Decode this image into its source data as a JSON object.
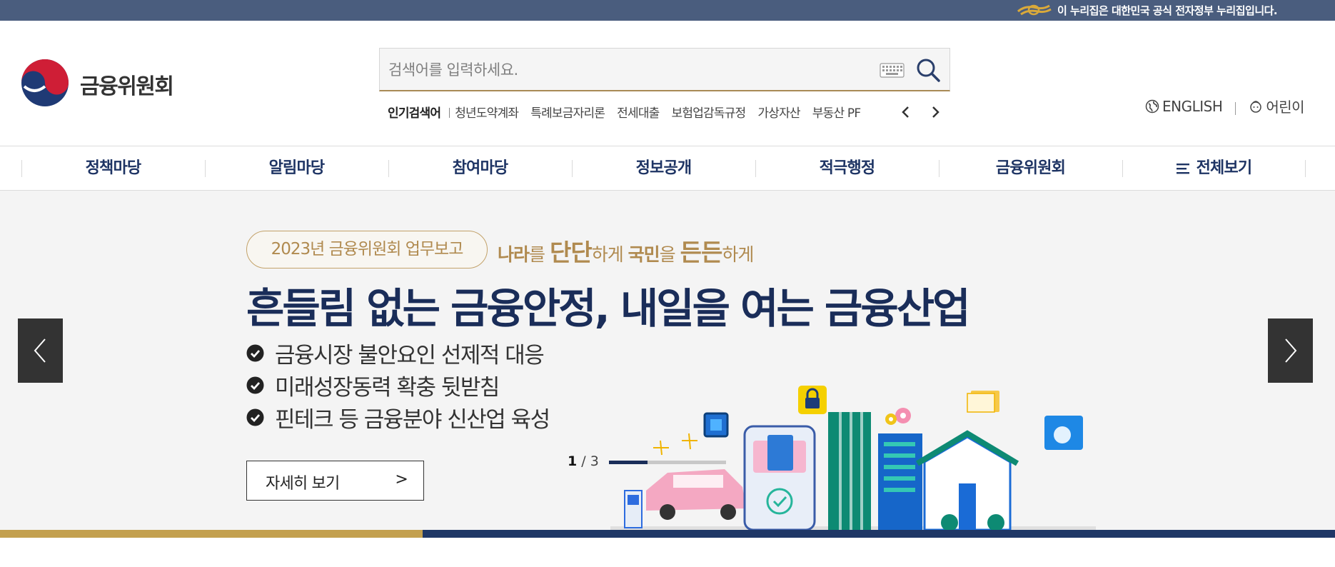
{
  "gov_banner": {
    "text": "이 누리집은 대한민국 공식 전자정부 누리집입니다.",
    "mark_icon": "egov-mark-icon"
  },
  "header": {
    "logo_text": "금융위원회",
    "search": {
      "placeholder": "검색어를 입력하세요.",
      "value": ""
    },
    "popular": {
      "title": "인기검색어",
      "keywords": [
        "청년도약계좌",
        "특례보금자리론",
        "전세대출",
        "보험업감독규정",
        "가상자산",
        "부동산 PF"
      ]
    },
    "util": {
      "english": "ENGLISH",
      "kids": "어린이"
    }
  },
  "nav": {
    "items": [
      "정책마당",
      "알림마당",
      "참여마당",
      "정보공개",
      "적극행정",
      "금융위원회",
      "전체보기"
    ]
  },
  "visual": {
    "badge": "2023년 금융위원회 업무보고",
    "slogan": {
      "p1": "나라",
      "p2": "를 ",
      "p3": "단단",
      "p4": "하게 ",
      "p5": "국민",
      "p6": "을 ",
      "p7": "든든",
      "p8": "하게"
    },
    "title": "흔들림 없는 금융안정, 내일을 여는 금융산업",
    "bullets": [
      "금융시장 불안요인 선제적 대응",
      "미래성장동력 확충 뒷받침",
      "핀테크 등 금융분야 신산업 육성"
    ],
    "more_label": "자세히 보기",
    "more_arrow": ">",
    "pager": {
      "current": "1",
      "total": "/ 3"
    },
    "progress": 0.33
  },
  "colors": {
    "gov_bar": "#4a5d7e",
    "navy": "#1a2d59",
    "gold": "#c3a04f",
    "arrow_bg": "#333333"
  }
}
